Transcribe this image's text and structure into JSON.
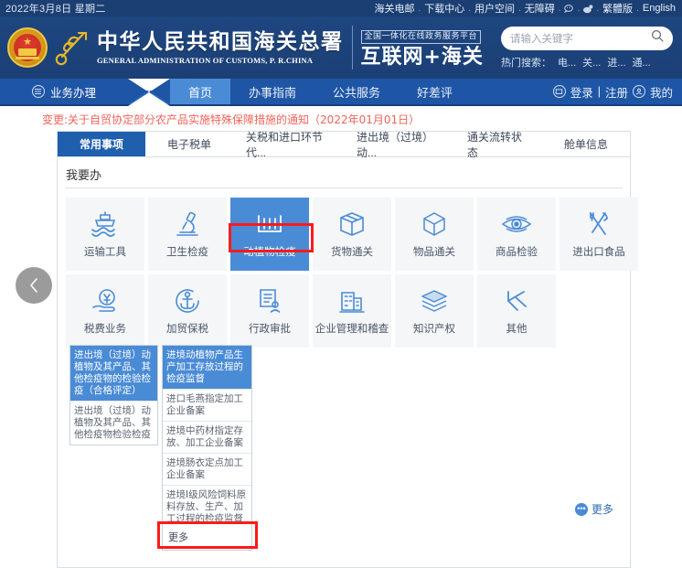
{
  "topbar": {
    "date": "2022年3月8日  星期二",
    "links": [
      {
        "label": "海关电邮",
        "type": "text"
      },
      {
        "label": "下载中心",
        "type": "text"
      },
      {
        "label": "用户空间",
        "type": "text"
      },
      {
        "label": "无障碍",
        "type": "text"
      },
      {
        "label": "wechat-icon",
        "type": "icon"
      },
      {
        "label": "weibo-icon",
        "type": "icon"
      },
      {
        "label": "繁體版",
        "type": "text"
      },
      {
        "label": "English",
        "type": "text"
      }
    ],
    "separator": "."
  },
  "header": {
    "emblem_name": "national-emblem",
    "caduceus_name": "customs-caduceus-emblem",
    "title_cn": "中华人民共和国海关总署",
    "title_en": "GENERAL ADMINISTRATION OF CUSTOMS, P. R.CHINA",
    "platform_tag": "全国一体化在线政务服务平台",
    "platform_title": "互联网+海关",
    "search": {
      "placeholder": "请输入关键字",
      "value": "",
      "icon": "search-icon"
    },
    "hot_label": "热门搜索：",
    "hot_items": [
      "电...",
      "关...",
      "进...",
      "通..."
    ]
  },
  "nav": {
    "menu_icon": "hamburger-icon",
    "biz_label": "业务办理",
    "items": [
      {
        "label": "首页",
        "active": true
      },
      {
        "label": "办事指南",
        "active": false
      },
      {
        "label": "公共服务",
        "active": false
      },
      {
        "label": "好差评",
        "active": false
      }
    ],
    "login_icon": "monitor-icon",
    "login": "登录",
    "divider": "|",
    "register": "注册",
    "user_icon": "user-circle-icon",
    "mine": "我的"
  },
  "notice": {
    "text": "变更:关于自贸协定部分农产品实施特殊保障措施的通知（2022年01月01日）",
    "color": "#f0645a"
  },
  "tabs": [
    {
      "label": "常用事项",
      "active": true
    },
    {
      "label": "电子税单",
      "active": false
    },
    {
      "label": "关税和进口环节代...",
      "active": false
    },
    {
      "label": "进出境（过境）动...",
      "active": false
    },
    {
      "label": "通关流转状态",
      "active": false
    },
    {
      "label": "舱单信息",
      "active": false
    }
  ],
  "section": {
    "title": "我要办"
  },
  "tiles": [
    {
      "label": "运输工具",
      "icon": "ship-icon",
      "selected": false
    },
    {
      "label": "卫生检疫",
      "icon": "microscope-icon",
      "selected": false
    },
    {
      "label": "动植物检疫",
      "icon": "containers-icon",
      "selected": true
    },
    {
      "label": "货物通关",
      "icon": "package-icon",
      "selected": false
    },
    {
      "label": "物品通关",
      "icon": "cube-icon",
      "selected": false
    },
    {
      "label": "商品检验",
      "icon": "eye-inspect-icon",
      "selected": false
    },
    {
      "label": "进出口食品",
      "icon": "fork-knife-icon",
      "selected": false
    },
    {
      "label": "税费业务",
      "icon": "yuan-hand-icon",
      "selected": false
    },
    {
      "label": "加贸保税",
      "icon": "anchor-icon",
      "selected": false
    },
    {
      "label": "行政审批",
      "icon": "document-approval-icon",
      "selected": false
    },
    {
      "label": "企业管理和稽查",
      "icon": "building-icon",
      "selected": false
    },
    {
      "label": "知识产权",
      "icon": "books-stack-icon",
      "selected": false
    },
    {
      "label": "其他",
      "icon": "pin-icon",
      "selected": false
    }
  ],
  "submenu_left": {
    "header": "进出境（过境）动植物及其产品、其他检疫物的检验检疫（合格评定）",
    "items": [
      "进出境（过境）动植物及其产品、其他检疫物检验检疫"
    ]
  },
  "submenu_right": {
    "header": "进境动植物产品生产加工存放过程的检疫监督",
    "items": [
      "进口毛燕指定加工企业备案",
      "进境中药材指定存放、加工企业备案",
      "进境肠衣定点加工企业备案",
      "进境Ⅰ级风险饲料原料存放、生产、加工过程的检疫监督"
    ],
    "more": "更多"
  },
  "more_link": {
    "label": "更多",
    "icon": "more-dots-icon"
  },
  "carousel": {
    "prev_icon": "chevron-left-icon"
  },
  "colors": {
    "topbar_bg": "#1b3f72",
    "header_bg": "#1e4680",
    "nav_bg": "#1f55a5",
    "accent": "#4a8bd6",
    "tab_active": "#1f5fad",
    "notice": "#f0645a",
    "annotation": "#ff1a1a"
  }
}
